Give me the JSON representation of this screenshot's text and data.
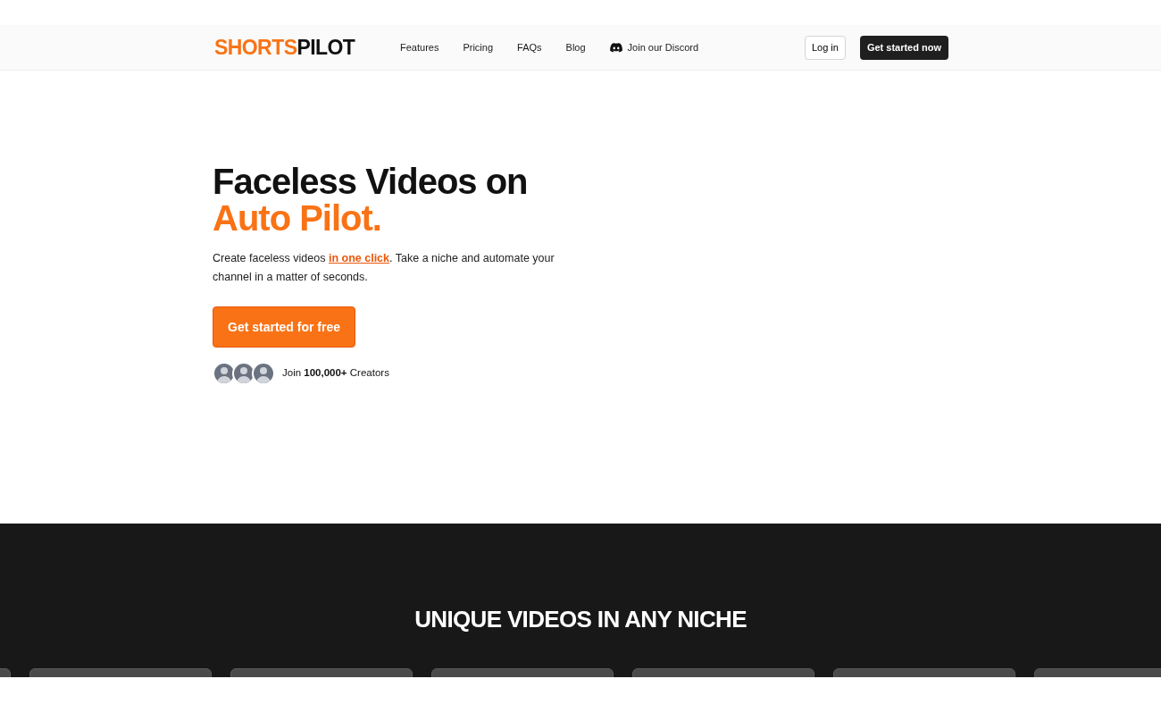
{
  "header": {
    "logo": {
      "accent": "SHORTS",
      "rest": "PILOT"
    },
    "nav": [
      {
        "label": "Features",
        "kind": "link"
      },
      {
        "label": "Pricing",
        "kind": "link"
      },
      {
        "label": "FAQs",
        "kind": "link"
      },
      {
        "label": "Blog",
        "kind": "link"
      },
      {
        "label": "Join our Discord",
        "kind": "discord"
      }
    ],
    "login": "Log in",
    "cta": "Get started now"
  },
  "hero": {
    "title": "Faceless Videos on",
    "title_accent": "Auto Pilot.",
    "text_before": "Create faceless videos",
    "link": "in one click",
    "text_after": ". Take a niche and automate your channel in a matter of seconds.",
    "button": "Get started for free",
    "avatars": [
      {
        "kind": "photo"
      },
      {
        "kind": "photo"
      },
      {
        "kind": "photo"
      }
    ],
    "social_proof": "Join **100,000+** Creators"
  },
  "section": {
    "title": "UNIQUE VIDEOS IN ANY NICHE",
    "cards": [
      {
        "kind": "video"
      },
      {
        "kind": "video"
      },
      {
        "kind": "video"
      },
      {
        "kind": "video"
      },
      {
        "kind": "video"
      },
      {
        "kind": "video"
      },
      {
        "kind": "video"
      }
    ]
  }
}
